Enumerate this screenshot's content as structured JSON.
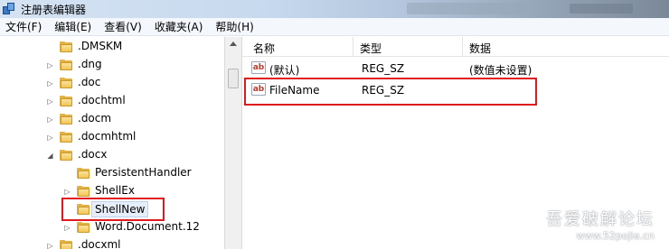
{
  "window": {
    "title": "注册表编辑器"
  },
  "menu": [
    "文件(F)",
    "编辑(E)",
    "查看(V)",
    "收藏夹(A)",
    "帮助(H)"
  ],
  "tree": {
    "items": [
      {
        "label": ".DMSKM",
        "expander": ""
      },
      {
        "label": ".dng",
        "expander": "▷"
      },
      {
        "label": ".doc",
        "expander": "▷"
      },
      {
        "label": ".dochtml",
        "expander": "▷"
      },
      {
        "label": ".docm",
        "expander": "▷"
      },
      {
        "label": ".docmhtml",
        "expander": "▷"
      },
      {
        "label": ".docx",
        "expander": "◢"
      },
      {
        "label": "PersistentHandler",
        "expander": ""
      },
      {
        "label": "ShellEx",
        "expander": "▷"
      },
      {
        "label": "ShellNew",
        "expander": ""
      },
      {
        "label": "Word.Document.12",
        "expander": "▷"
      },
      {
        "label": ".docxml",
        "expander": "▷"
      }
    ]
  },
  "list": {
    "columns": [
      "名称",
      "类型",
      "数据"
    ],
    "rows": [
      {
        "name": "(默认)",
        "type": "REG_SZ",
        "data": "(数值未设置)",
        "icon": "ab"
      },
      {
        "name": "FileName",
        "type": "REG_SZ",
        "data": "",
        "icon": "ab"
      }
    ]
  },
  "watermark": {
    "text": "吾爱破解论坛",
    "url": "www.52pojie.cn"
  }
}
